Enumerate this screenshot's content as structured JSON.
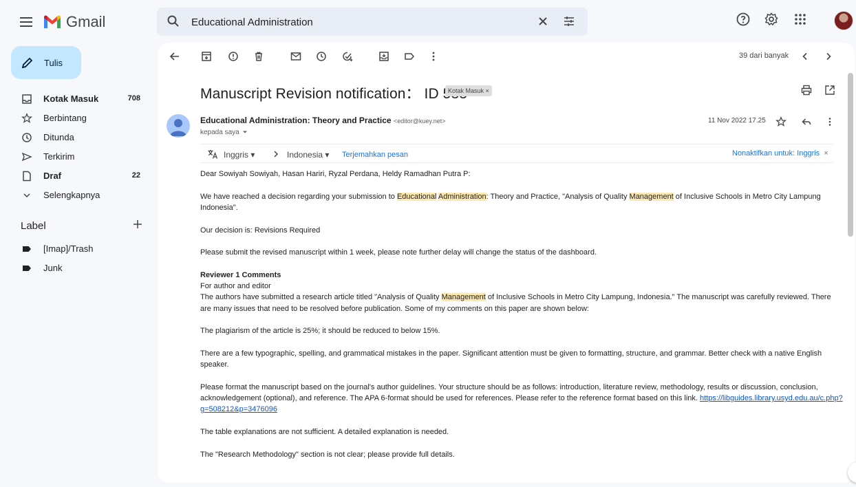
{
  "app": {
    "name": "Gmail"
  },
  "search": {
    "value": "Educational Administration"
  },
  "compose": {
    "label": "Tulis"
  },
  "nav": [
    {
      "label": "Kotak Masuk",
      "count": "708",
      "bold": true,
      "icon": "inbox-icon"
    },
    {
      "label": "Berbintang",
      "count": "",
      "bold": false,
      "icon": "star-icon"
    },
    {
      "label": "Ditunda",
      "count": "",
      "bold": false,
      "icon": "clock-icon"
    },
    {
      "label": "Terkirim",
      "count": "",
      "bold": false,
      "icon": "send-icon"
    },
    {
      "label": "Draf",
      "count": "22",
      "bold": true,
      "icon": "draft-icon"
    },
    {
      "label": "Selengkapnya",
      "count": "",
      "bold": false,
      "icon": "chevron-down-icon"
    }
  ],
  "labels": {
    "heading": "Label",
    "items": [
      {
        "label": "[Imap]/Trash"
      },
      {
        "label": "Junk"
      }
    ]
  },
  "toolbar": {
    "pager": "39 dari banyak"
  },
  "email": {
    "subject": "Manuscript Revision notification： ID 533",
    "chip": "Kotak Masuk ×",
    "sender_name": "Educational Administration: Theory and Practice",
    "sender_email": "<editor@kuey.net>",
    "to": "kepada saya",
    "date": "11 Nov 2022 17.25"
  },
  "translate": {
    "from": "Inggris",
    "to": "Indonesia",
    "link": "Terjemahkan pesan",
    "disable": "Nonaktifkan untuk: Inggris"
  },
  "body": {
    "greeting": "Dear Sowiyah Sowiyah, Hasan Hariri, Ryzal Perdana, Heldy Ramadhan Putra P:",
    "p1_a": "We have reached a decision regarding your submission to ",
    "p1_hl1": "Educational",
    "p1_sp": " ",
    "p1_hl2": "Administration",
    "p1_b": ": Theory and Practice, \"Analysis of Quality ",
    "p1_hl3": "Management",
    "p1_c": " of Inclusive Schools in Metro City Lampung Indonesia\".",
    "decision": "Our decision is: Revisions Required",
    "submit": "Please submit the revised manuscript within 1 week, please note further delay will change the status of the dashboard.",
    "reviewer_heading": "Reviewer 1 Comments",
    "for_author": "For author and editor",
    "r1_a": "The authors have submitted a research article titled \"Analysis of Quality ",
    "r1_hl": "Management",
    "r1_b": " of Inclusive Schools in Metro City Lampung, Indonesia.\" The manuscript was carefully reviewed. There are many issues that need to be resolved before publication. Some of my comments on this paper are shown below:",
    "plagiarism": "The plagiarism of the article is 25%; it should be reduced to below 15%.",
    "typo": "There are a few typographic, spelling, and grammatical mistakes in the paper. Significant attention must be given to formatting, structure, and grammar. Better check with a native English speaker.",
    "format_a": "Please format the manuscript based on the journal's author guidelines. Your structure should be as follows: introduction, literature review, methodology, results or discussion, conclusion, acknowledgement (optional), and reference. The APA 6-format should be used for references. Please refer to the reference format based on this link. ",
    "format_link": "https://libguides.library.usyd.edu.au/c.php?g=508212&p=3476096",
    "table": "The table explanations are not sufficient. A detailed explanation is needed.",
    "method": "The \"Research Methodology\" section is not clear; please provide full details."
  },
  "colors": {
    "compose_bg": "#c2e7ff",
    "highlight": "#fce8b2",
    "link": "#1155cc",
    "translate_link": "#1a73e8"
  }
}
